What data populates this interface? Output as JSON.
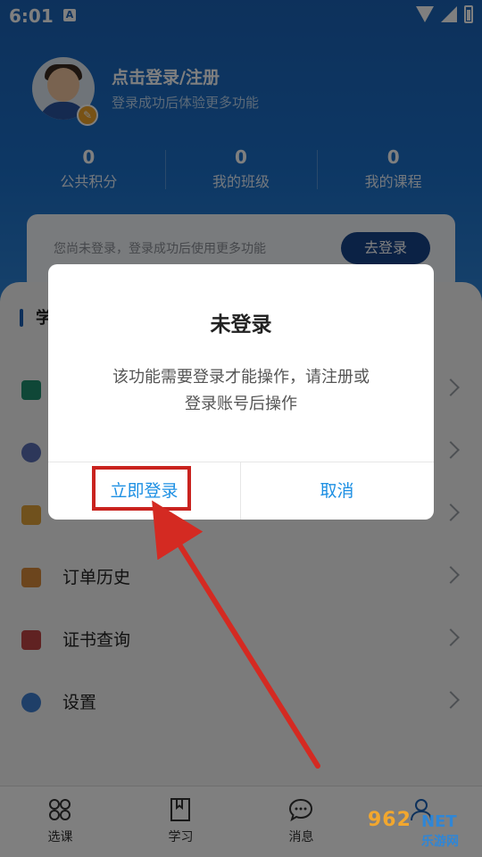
{
  "status_bar": {
    "time": "6:01",
    "notification_letter": "A"
  },
  "profile": {
    "title": "点击登录/注册",
    "subtitle": "登录成功后体验更多功能",
    "stats": [
      {
        "value": "0",
        "label": "公共积分"
      },
      {
        "value": "0",
        "label": "我的班级"
      },
      {
        "value": "0",
        "label": "我的课程"
      }
    ]
  },
  "login_prompt": {
    "text": "您尚未登录，登录成功后使用更多功能",
    "button": "去登录"
  },
  "section": {
    "title": "学"
  },
  "menu": {
    "items": [
      {
        "label": "",
        "icon": "book-icon",
        "color": "#1f8f6e"
      },
      {
        "label": "",
        "icon": "badge-icon",
        "color": "#5a6fb5"
      },
      {
        "label": "",
        "icon": "notepad-icon",
        "color": "#e0a33a"
      },
      {
        "label": "订单历史",
        "icon": "order-history-icon",
        "color": "#d98b3a"
      },
      {
        "label": "证书查询",
        "icon": "certificate-icon",
        "color": "#c04545"
      },
      {
        "label": "设置",
        "icon": "settings-user-icon",
        "color": "#3f7fd0"
      }
    ]
  },
  "tabbar": {
    "tabs": [
      {
        "label": "选课",
        "icon": "grid-icon"
      },
      {
        "label": "学习",
        "icon": "bookmark-icon"
      },
      {
        "label": "消息",
        "icon": "chat-icon"
      },
      {
        "label": "",
        "icon": "user-icon"
      }
    ]
  },
  "dialog": {
    "title": "未登录",
    "message_line1": "该功能需要登录才能操作，请注册或",
    "message_line2": "登录账号后操作",
    "confirm": "立即登录",
    "cancel": "取消"
  },
  "watermark": {
    "number": "962",
    "net": "NET",
    "text": "乐游网"
  },
  "colors": {
    "header_top": "#1b63b8",
    "dialog_button": "#1c8fe3",
    "highlight": "#c9231f"
  }
}
